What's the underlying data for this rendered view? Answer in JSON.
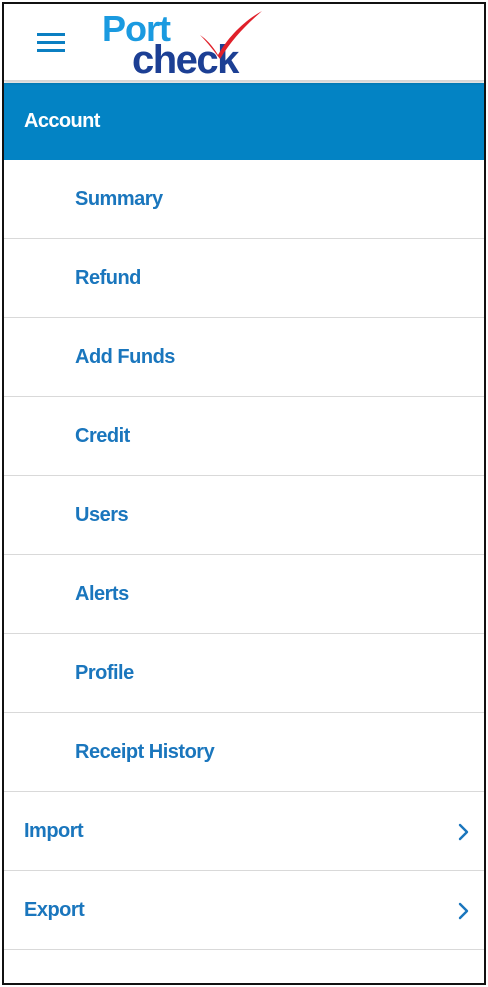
{
  "header": {
    "menu_icon": "hamburger-icon",
    "logo": {
      "word1": "Port",
      "word2": "check",
      "tick_icon": "checkmark-icon"
    }
  },
  "colors": {
    "accent": "#0383c4",
    "link": "#1a76bd",
    "logo_light": "#1a9ae0",
    "logo_dark": "#1c3f94",
    "logo_tick": "#e0202a"
  },
  "nav": {
    "section_title": "Account",
    "sub_items": [
      {
        "label": "Summary"
      },
      {
        "label": "Refund"
      },
      {
        "label": "Add Funds"
      },
      {
        "label": "Credit"
      },
      {
        "label": "Users"
      },
      {
        "label": "Alerts"
      },
      {
        "label": "Profile"
      },
      {
        "label": "Receipt History"
      }
    ],
    "top_items": [
      {
        "label": "Import",
        "icon": "chevron-right-icon"
      },
      {
        "label": "Export",
        "icon": "chevron-right-icon"
      }
    ]
  }
}
